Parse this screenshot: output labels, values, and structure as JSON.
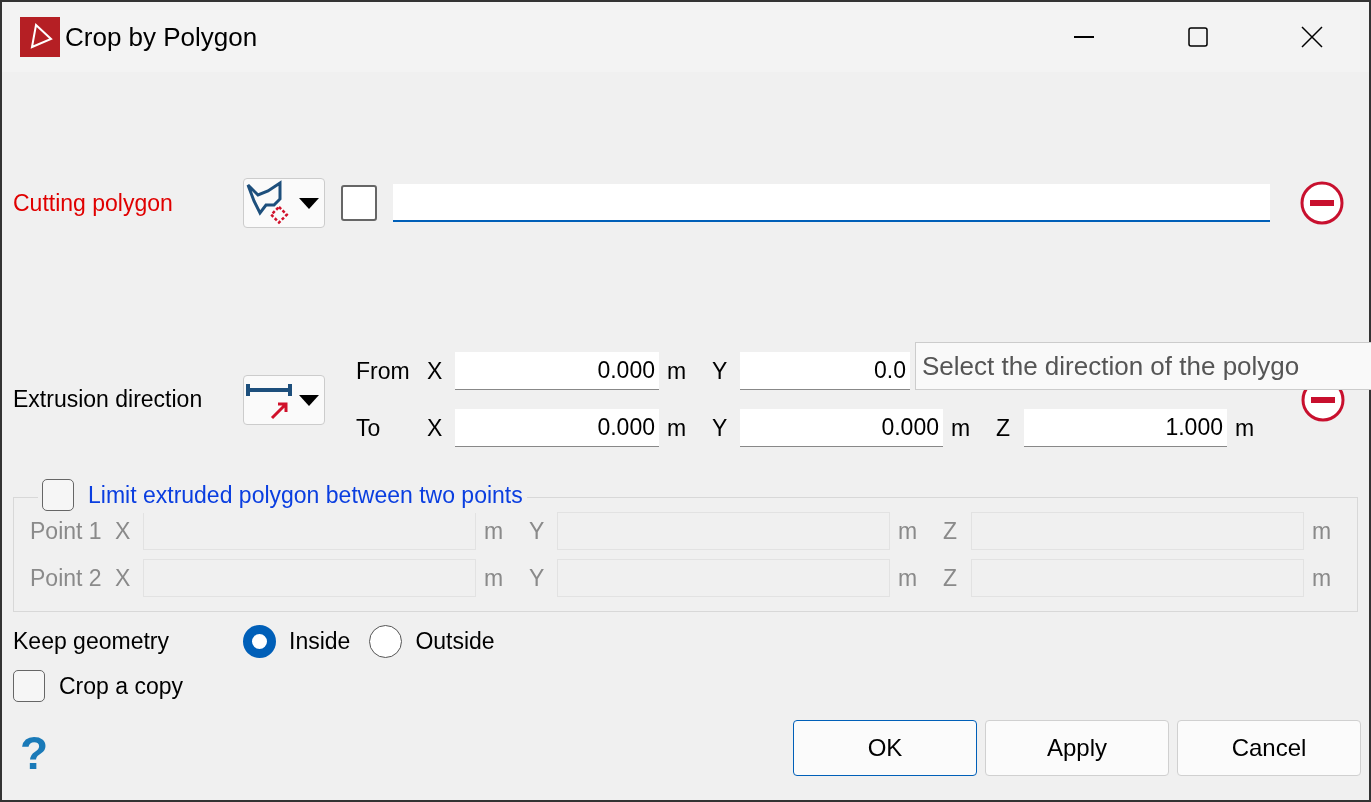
{
  "window": {
    "title": "Crop by Polygon"
  },
  "cutting_polygon": {
    "label": "Cutting polygon",
    "checked": false
  },
  "extrusion": {
    "label": "Extrusion direction",
    "rows": [
      {
        "label": "From",
        "fields": [
          {
            "axis": "X",
            "value": "0.000",
            "unit": "m"
          },
          {
            "axis": "Y",
            "value": "0.0"
          }
        ]
      },
      {
        "label": "To",
        "fields": [
          {
            "axis": "X",
            "value": "0.000",
            "unit": "m"
          },
          {
            "axis": "Y",
            "value": "0.000",
            "unit": "m"
          },
          {
            "axis": "Z",
            "value": "1.000",
            "unit": "m"
          }
        ]
      }
    ]
  },
  "tooltip": "Select the direction of the polygo",
  "limit": {
    "label": "Limit extruded polygon between two points",
    "checked": false,
    "disabled": true,
    "rows": [
      {
        "label": "Point 1",
        "fields": [
          {
            "axis": "X",
            "unit": "m"
          },
          {
            "axis": "Y",
            "unit": "m"
          },
          {
            "axis": "Z",
            "unit": "m"
          }
        ]
      },
      {
        "label": "Point 2",
        "fields": [
          {
            "axis": "X",
            "unit": "m"
          },
          {
            "axis": "Y",
            "unit": "m"
          },
          {
            "axis": "Z",
            "unit": "m"
          }
        ]
      }
    ]
  },
  "keep_geometry": {
    "label": "Keep geometry",
    "options": [
      {
        "label": "Inside",
        "selected": true
      },
      {
        "label": "Outside",
        "selected": false
      }
    ]
  },
  "crop_copy": {
    "label": "Crop a copy",
    "checked": false
  },
  "help": "?",
  "buttons": [
    {
      "label": "OK",
      "default": true
    },
    {
      "label": "Apply",
      "default": false
    },
    {
      "label": "Cancel",
      "default": false
    }
  ]
}
